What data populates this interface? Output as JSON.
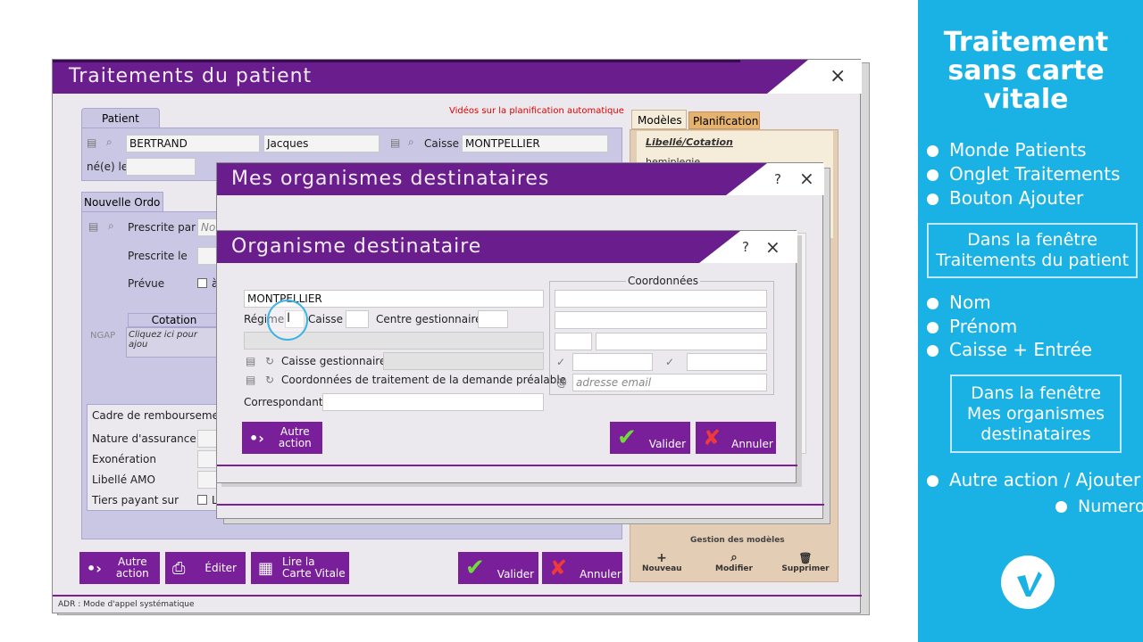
{
  "patient_window": {
    "title": "Traitements du patient",
    "close": "×",
    "tab_patient": "Patient",
    "video_link": "Vidéos sur la planification automatique",
    "nom": "BERTRAND",
    "prenom": "Jacques",
    "caisse_label": "Caisse",
    "caisse_value": "MONTPELLIER",
    "ne_le_label": "né(e) le",
    "tab_modeles": "Modèles",
    "tab_planification": "Planification",
    "libelle_cotation": "Libellé/Cotation",
    "hemiplegie": "hemiplegie",
    "tab_nouvelle_ordo": "Nouvelle Ordo",
    "prescrite_par_label": "Prescrite par",
    "prescrite_par_placeholder": "Non",
    "prescrite_le_label": "Prescrite le",
    "prevue_label": "Prévue",
    "prevue_suffix": "à",
    "cotation_header": "Cotation",
    "ngap_label": "NGAP",
    "cotation_placeholder": "Cliquez ici pour ajou",
    "cadre_remboursement": "Cadre de remboursement",
    "nature_assurance": "Nature d'assurance",
    "exoneration": "Exonération",
    "libelle_amo": "Libellé AMO",
    "tiers_payant": "Tiers payant sur",
    "tiers_suffix": "L",
    "gestion_modeles": "Gestion des modèles",
    "nouveau": "Nouveau",
    "modifier": "Modifier",
    "supprimer": "Supprimer",
    "autre_action": "Autre\naction",
    "editer": "Éditer",
    "lire_carte": "Lire la\nCarte Vitale",
    "valider": "Valider",
    "annuler": "Annuler",
    "status": "ADR : Mode d'appel systématique"
  },
  "organismes_window": {
    "title": "Mes organismes destinataires",
    "help": "?",
    "close": "×"
  },
  "organisme_dialog": {
    "title": "Organisme destinataire",
    "help": "?",
    "close": "×",
    "name_value": "MONTPELLIER",
    "regime_label": "Régime",
    "caisse_label": "Caisse",
    "centre_label": "Centre gestionnaire",
    "caisse_gest_label": "Caisse gestionnaire",
    "coord_demande_label": "Coordonnées de traitement de la demande préalable",
    "correspondant_label": "Correspondant",
    "coordonnees_title": "Coordonnées",
    "email_placeholder": "adresse email",
    "autre_action_1": "Autre",
    "autre_action_2": "action",
    "valider": "Valider",
    "annuler": "Annuler"
  },
  "sidebar": {
    "title": "Traitement\nsans carte\nvitale",
    "items1": [
      "Monde Patients",
      "Onglet Traitements",
      "Bouton Ajouter"
    ],
    "box1": "Dans la fenêtre\nTraitements du patient",
    "items2": [
      "Nom",
      "Prénom",
      "Caisse + Entrée"
    ],
    "box2": "Dans la fenêtre\nMes organismes\ndestinataires",
    "item3": "Autre action / Ajouter",
    "item4": "Numero",
    "bg_color": "#1ab2e4"
  }
}
